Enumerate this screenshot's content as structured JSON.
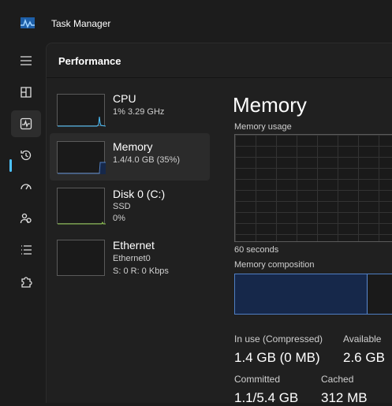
{
  "window": {
    "title": "Task Manager"
  },
  "nav": {
    "items": [
      {
        "name": "menu",
        "icon": "hamburger-menu-icon"
      },
      {
        "name": "processes",
        "icon": "processes-grid-icon"
      },
      {
        "name": "performance",
        "icon": "performance-graph-icon",
        "active": true
      },
      {
        "name": "app-history",
        "icon": "history-icon"
      },
      {
        "name": "startup-apps",
        "icon": "startup-gauge-icon"
      },
      {
        "name": "users",
        "icon": "users-icon"
      },
      {
        "name": "details",
        "icon": "details-list-icon"
      },
      {
        "name": "services",
        "icon": "services-puzzle-icon"
      }
    ]
  },
  "page": {
    "title": "Performance"
  },
  "resources": [
    {
      "name": "CPU",
      "line1": "1% 3.29 GHz",
      "line2": "",
      "selected": false
    },
    {
      "name": "Memory",
      "line1": "1.4/4.0 GB (35%)",
      "line2": "",
      "selected": true
    },
    {
      "name": "Disk 0 (C:)",
      "line1": "SSD",
      "line2": "0%",
      "selected": false
    },
    {
      "name": "Ethernet",
      "line1": "Ethernet0",
      "line2": "S: 0 R: 0 Kbps",
      "selected": false
    }
  ],
  "detail": {
    "title": "Memory",
    "usage_label": "Memory usage",
    "time_label": "60 seconds",
    "composition_label": "Memory composition",
    "composition": {
      "in_use_fraction": 0.35,
      "modified_fraction": 0.02
    },
    "stats": {
      "in_use_label": "In use (Compressed)",
      "in_use_value": "1.4 GB (0 MB)",
      "available_label": "Available",
      "available_value": "2.6 GB",
      "committed_label": "Committed",
      "committed_value": "1.1/5.4 GB",
      "cached_label": "Cached",
      "cached_value": "312 MB"
    }
  },
  "colors": {
    "accent": "#4cc2ff",
    "memory_line": "#4f7fc4",
    "memory_fill": "#16284a"
  }
}
